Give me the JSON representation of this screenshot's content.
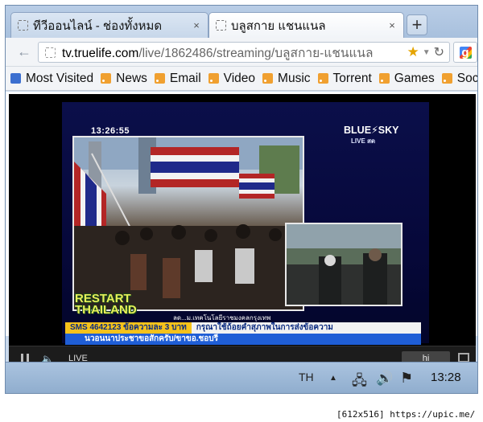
{
  "browser": {
    "tabs": [
      {
        "title": "ทีวีออนไลน์ - ช่องทั้งหมด",
        "active": false
      },
      {
        "title": "บลูสกาย แชนแนล",
        "active": true
      }
    ],
    "new_tab_label": "+",
    "close_label": "×",
    "back_label": "←",
    "url_host": "tv.truelife.com",
    "url_path": "/live/1862486/streaming/บลูสกาย-แชนแนล",
    "star_icon": "star-icon",
    "reload_label": "C",
    "dropdown_label": "▼",
    "search_engine_icon": "google-icon",
    "search_engine_glyph": "g",
    "search_dropdown": "▾"
  },
  "bookmarks": [
    {
      "label": "Most Visited",
      "icon": "most-visited-icon"
    },
    {
      "label": "News",
      "icon": "rss-icon"
    },
    {
      "label": "Email",
      "icon": "rss-icon"
    },
    {
      "label": "Video",
      "icon": "rss-icon"
    },
    {
      "label": "Music",
      "icon": "rss-icon"
    },
    {
      "label": "Torrent",
      "icon": "rss-icon"
    },
    {
      "label": "Games",
      "icon": "rss-icon"
    },
    {
      "label": "Social",
      "icon": "rss-icon"
    }
  ],
  "video": {
    "overlay_time": "13:26:55",
    "channel_brand": "BLUE⚡SKY",
    "channel_live": "LIVE สด",
    "logo_line1": "RESTART",
    "logo_line2": "THAILAND",
    "logo_caption": "ลด...ม.เทคโนโลยีราชมงคลกรุงเทพ",
    "ticker_sms": "SMS 4642123 ข้อความละ 3 บาท",
    "ticker_message": "กรุณาใช้ถ้อยคำสุภาพในการส่งข้อความ",
    "ticker_bottom": "นวอนนาประชาขอสักครับ/ขาขอ.ชอบรี"
  },
  "player": {
    "live_label": "LIVE",
    "quality_label": "hi"
  },
  "taskbar": {
    "language": "TH",
    "time": "13:28"
  },
  "watermark": "[612x516] https://upic.me/"
}
